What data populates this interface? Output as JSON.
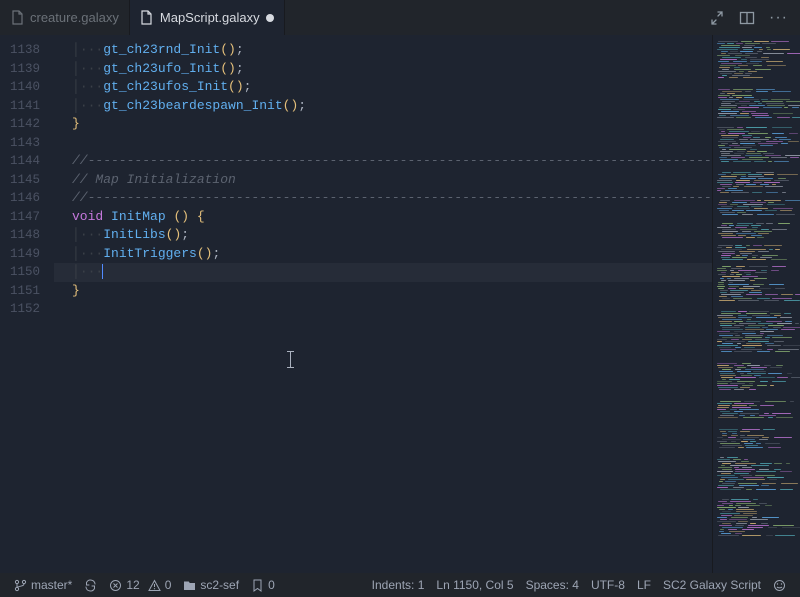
{
  "tabs": [
    {
      "name": "creature.galaxy",
      "active": false,
      "dirty": false
    },
    {
      "name": "MapScript.galaxy",
      "active": true,
      "dirty": true
    }
  ],
  "gutter_start": 1138,
  "gutter_end": 1152,
  "code": {
    "l1138": "gt_ch23rnd_Init",
    "l1139": "gt_ch23ufo_Init",
    "l1140": "gt_ch23ufos_Init",
    "l1141": "gt_ch23beardespawn_Init",
    "comment_rule": "//--------------------------------------------------------------------------------------------------",
    "comment_title": "// Map Initialization",
    "fn_type": "void",
    "fn_name": "InitMap",
    "call1": "InitLibs",
    "call2": "InitTriggers"
  },
  "status": {
    "branch": "master*",
    "errors": "12",
    "warnings": "0",
    "folder": "sc2-sef",
    "bookmarks": "0",
    "indents": "Indents: 1",
    "lncol": "Ln 1150, Col 5",
    "spaces": "Spaces: 4",
    "encoding": "UTF-8",
    "eol": "LF",
    "language": "SC2 Galaxy Script"
  }
}
